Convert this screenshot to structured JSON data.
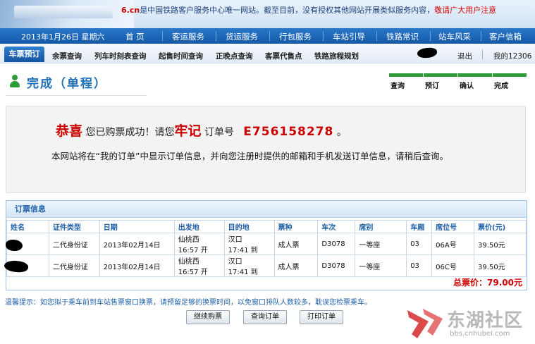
{
  "banner": {
    "domain": "6.cn",
    "notice_blue_1": "是中国铁路客户服务中心唯一网站。截至目前，没有授权其他网站开展类似服务内容，",
    "notice_red": "敬请广大用户注意"
  },
  "mainnav": {
    "date": "2013年1月26日 星期六",
    "items": [
      "首 页",
      "客运服务",
      "货运服务",
      "行包服务",
      "车站引导",
      "铁路常识",
      "站车风采",
      "客户信箱"
    ]
  },
  "subnav": {
    "active": "车票预订",
    "items": [
      "余票查询",
      "列车时刻表查询",
      "起售时间查询",
      "正晚点查询",
      "客票代售点",
      "铁路旅程规划"
    ],
    "logout": "退出",
    "my12306": "我的12306"
  },
  "page": {
    "title": "完成（单程）",
    "steps": [
      "查询",
      "预订",
      "确认",
      "完成"
    ]
  },
  "success": {
    "congrats": "恭喜",
    "text1": "您已购票成功！请您",
    "remember": "牢记",
    "text2": "订单号",
    "order_no": "E756158278",
    "end": "。",
    "info": "本网站将在“我的订单”中显示订单信息，并向您注册时提供的邮箱和手机发送订单信息，请稍后查询。"
  },
  "tickets": {
    "header": "订票信息",
    "columns": [
      "姓名",
      "证件类型",
      "日期",
      "出发地",
      "目的地",
      "票种",
      "车次",
      "席别",
      "车厢",
      "席位号",
      "票价(元)"
    ],
    "rows": [
      {
        "name": "",
        "id_type": "二代身份证",
        "date": "2013年02月14日",
        "from": "仙桃西",
        "dep": "16:57 开",
        "to": "汉口",
        "arr": "17:41 到",
        "ticket_type": "成人票",
        "train": "D3078",
        "seat_class": "一等座",
        "car": "03",
        "seat": "06A号",
        "price": "39.50元"
      },
      {
        "name": "",
        "id_type": "二代身份证",
        "date": "2013年02月14日",
        "from": "仙桃西",
        "dep": "16:57 开",
        "to": "汉口",
        "arr": "17:41 到",
        "ticket_type": "成人票",
        "train": "D3078",
        "seat_class": "一等座",
        "car": "03",
        "seat": "06C号",
        "price": "39.50元"
      }
    ],
    "total": "总票价：79.00元"
  },
  "tip": "温馨提示：如您拟于乘车前到车站售票窗口换票，请预留足够的换票时间，以免窗口排队人数较多，耽误您检票乘车。",
  "buttons": {
    "continue": "继续购票",
    "query": "查询订单",
    "print": "打印订单"
  },
  "watermark": {
    "brand": "东湖社区",
    "url": "bbs.cnhubei.com"
  },
  "colors": {
    "nav_blue": "#1459a8",
    "title_blue": "#1e6fb8",
    "step_green": "#2f9a38",
    "alert_red": "#cc0000"
  }
}
